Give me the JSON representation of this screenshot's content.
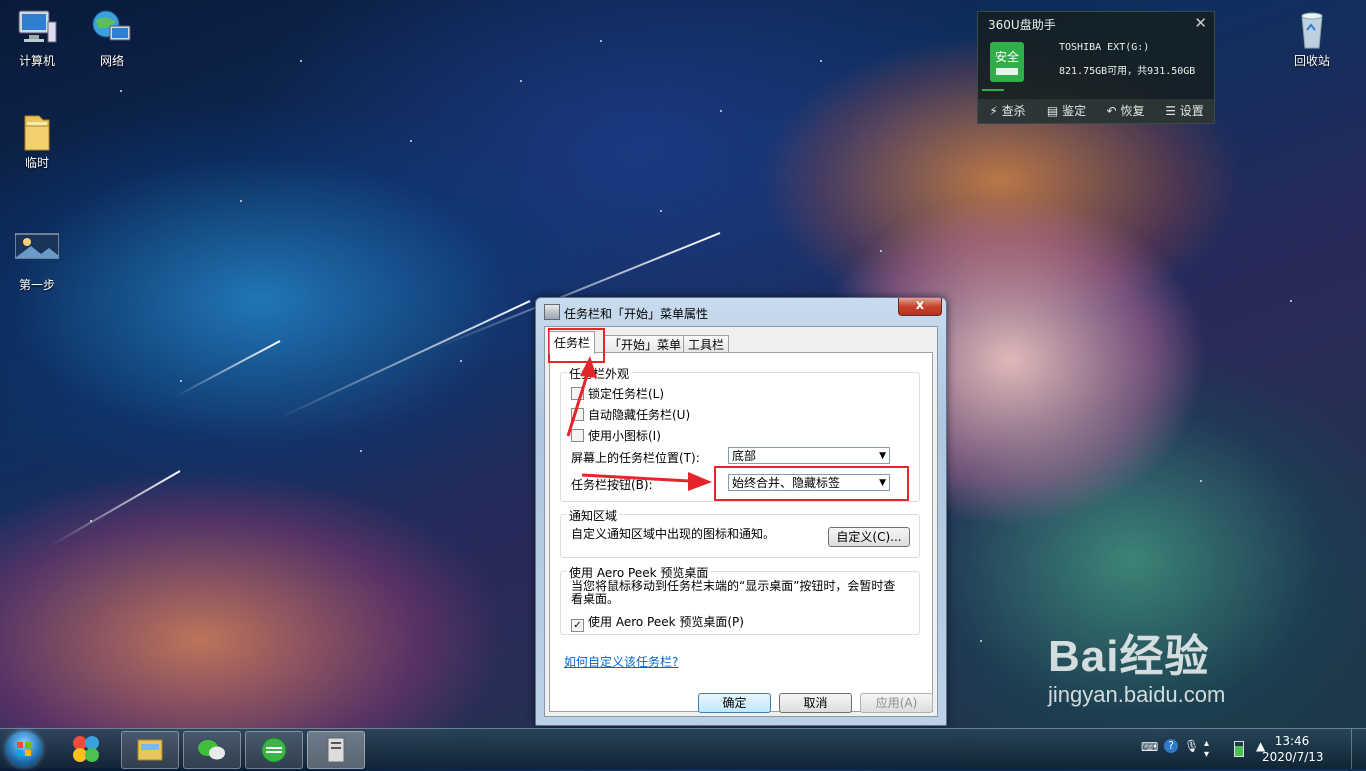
{
  "desktop": {
    "icons": [
      {
        "label": "计算机"
      },
      {
        "label": "网络"
      },
      {
        "label": "临时"
      },
      {
        "label": "第一步"
      },
      {
        "label": "回收站"
      }
    ]
  },
  "u_disk_helper": {
    "title": "360U盘助手",
    "status": "安全",
    "drive_name": "TOSHIBA EXT(G:)",
    "capacity": "821.75GB可用，共931.50GB",
    "actions": [
      "查杀",
      "鉴定",
      "恢复",
      "设置"
    ]
  },
  "dialog": {
    "title": "任务栏和「开始」菜单属性",
    "close_label": "x",
    "tabs": [
      "任务栏",
      "「开始」菜单",
      "工具栏"
    ],
    "appearance": {
      "label": "任务栏外观",
      "lock": "锁定任务栏(L)",
      "autohide": "自动隐藏任务栏(U)",
      "small_icons": "使用小图标(I)",
      "position_label": "屏幕上的任务栏位置(T):",
      "position_value": "底部",
      "buttons_label": "任务栏按钮(B):",
      "buttons_value": "始终合并、隐藏标签"
    },
    "notification": {
      "label": "通知区域",
      "text": "自定义通知区域中出现的图标和通知。",
      "customize": "自定义(C)..."
    },
    "aero": {
      "label": "使用 Aero Peek 预览桌面",
      "text": "当您将鼠标移动到任务栏末端的“显示桌面”按钮时，会暂时查看桌面。",
      "checkbox": "使用 Aero Peek 预览桌面(P)",
      "checked": true
    },
    "help_link": "如何自定义该任务栏?",
    "ok": "确定",
    "cancel": "取消",
    "apply": "应用(A)"
  },
  "clock": {
    "time": "13:46",
    "date": "2020/7/13"
  },
  "watermark": {
    "brand": "Bai经验",
    "url": "jingyan.baidu.com"
  },
  "colors": {
    "annotation_red": "#e5242b",
    "safe_green": "#2fae4a",
    "link_blue": "#0066cc"
  }
}
